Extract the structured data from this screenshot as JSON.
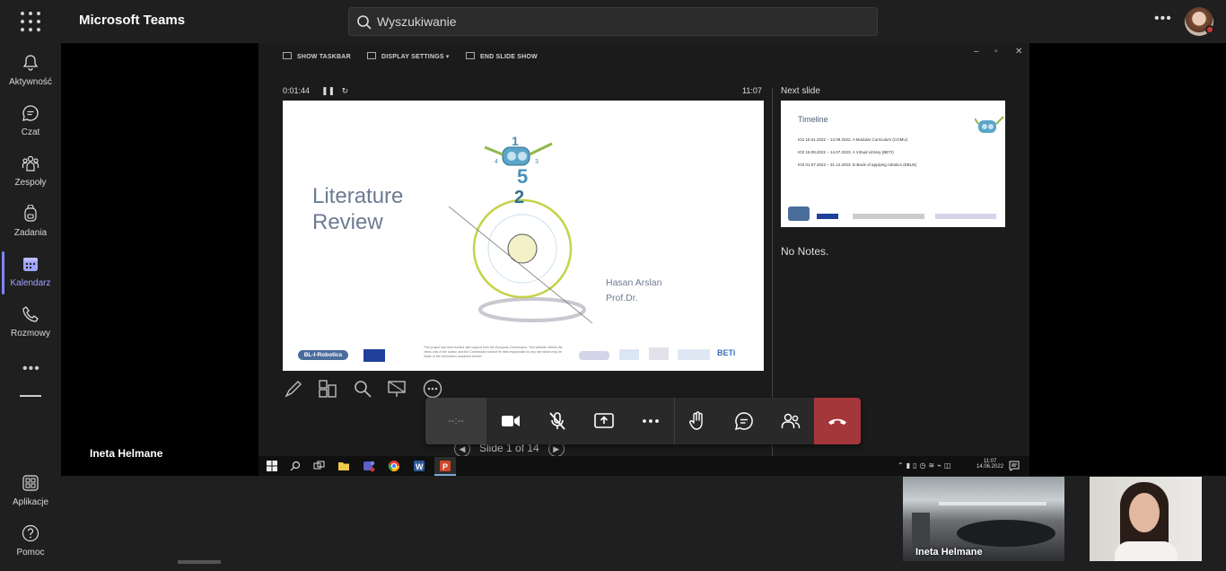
{
  "app": {
    "title": "Microsoft Teams"
  },
  "search": {
    "placeholder": "Wyszukiwanie"
  },
  "rail": {
    "items": [
      {
        "label": "Aktywność"
      },
      {
        "label": "Czat"
      },
      {
        "label": "Zespoły"
      },
      {
        "label": "Zadania"
      },
      {
        "label": "Kalendarz"
      },
      {
        "label": "Rozmowy"
      }
    ],
    "apps_label": "Aplikacje",
    "help_label": "Pomoc",
    "active_color": "#9ea2ff"
  },
  "presenter": {
    "name": "Ineta Helmane"
  },
  "powerpoint": {
    "toolbar": {
      "show_taskbar": "SHOW TASKBAR",
      "display_settings": "DISPLAY SETTINGS ▾",
      "end_show": "END SLIDE SHOW"
    },
    "elapsed": "0:01:44",
    "clock": "11:07",
    "next_slide_label": "Next slide",
    "notes": "No Notes.",
    "slide_nav": "Slide 1 of 14",
    "current_slide": {
      "title_line1": "Literature",
      "title_line2": "Review",
      "author": "Hasan Arslan",
      "author_title": "Prof.Dr.",
      "logo": "BL-I-Robotics",
      "partner": "BETi",
      "footer_text": "This project has been funded with support from the European Commission. This website reflects the views only of the author, and the Commission cannot be held responsible for any use which may be made of the information contained therein."
    },
    "next_slide": {
      "title": "Timeline",
      "items": [
        "IO1  15.01.2022  –  14.09.2022. A Modular Curriculum (COMU)",
        "IO2  15.09.2022  –  14.07.2023. A Virtual Library (BETI)",
        "IO3  01.07.2023  –  31.12.2023. E-Book of applying robotics (EBUS)"
      ]
    }
  },
  "taskbar": {
    "time": "11:07",
    "date": "14.06.2022"
  },
  "callbar": {
    "timer": "--:--",
    "hangup_color": "#a4373a"
  },
  "participants": [
    {
      "name": "Ineta Helmane"
    }
  ]
}
